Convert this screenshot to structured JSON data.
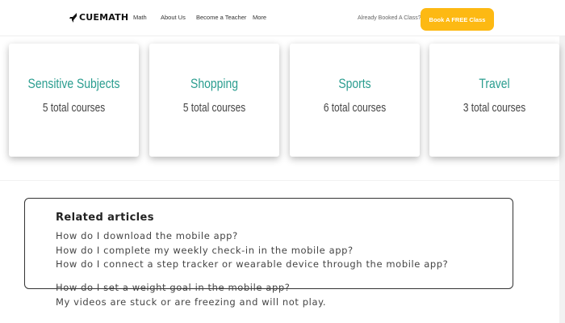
{
  "navbar": {
    "logo_text": "CUEMATH",
    "logo_icon": "rocket-icon",
    "links": [
      "Math",
      "About Us",
      "Become a Teacher",
      "More"
    ],
    "booked_text": "Already Booked A Class?",
    "cta_label": "Book A FREE Class",
    "cta_color": "#fdb913"
  },
  "categories": [
    {
      "title": "Sensitive Subjects",
      "count": "5 total courses"
    },
    {
      "title": "Shopping",
      "count": "5 total courses"
    },
    {
      "title": "Sports",
      "count": "6 total courses"
    },
    {
      "title": "Travel",
      "count": "3 total courses"
    }
  ],
  "category_title_color": "#2a9d8f",
  "related": {
    "title": "Related articles",
    "articles": [
      "How do I download the mobile app?",
      "How do I complete my weekly check-in in the mobile app?",
      "How do I connect a step tracker or wearable device through the mobile app?",
      "How do I set a weight goal in the mobile app?",
      "My videos are stuck or are freezing and will not play."
    ]
  }
}
